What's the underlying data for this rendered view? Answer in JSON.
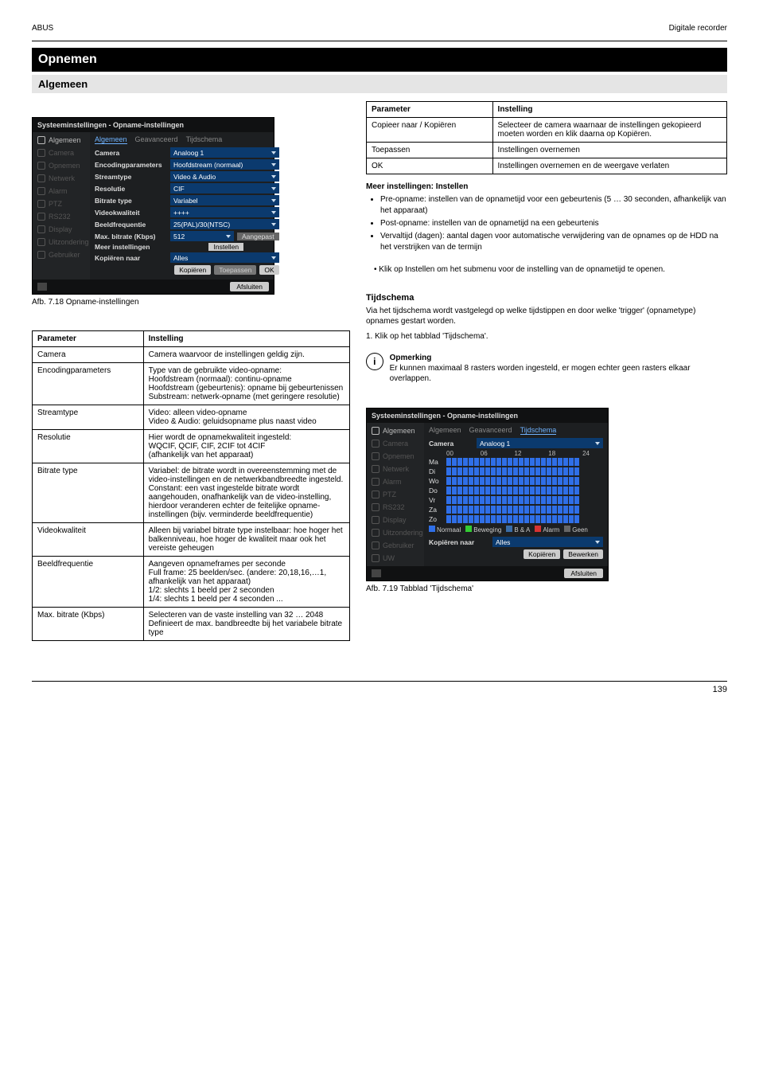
{
  "header": {
    "brand": "ABUS",
    "product": "Digitale recorder"
  },
  "section": {
    "title": "Opnemen",
    "subtitle": "Algemeen"
  },
  "fig1_caption": "Afb. 7.18 Opname-instellingen",
  "fig2_caption": "Afb. 7.19 Tabblad 'Tijdschema'",
  "ui1": {
    "window_title": "Systeeminstellingen - Opname-instellingen",
    "sidebar": [
      "Algemeen",
      "Camera",
      "Opnemen",
      "Netwerk",
      "Alarm",
      "PTZ",
      "RS232",
      "Display",
      "Uitzondering",
      "Gebruiker"
    ],
    "tabs": [
      "Algemeen",
      "Geavanceerd",
      "Tijdschema"
    ],
    "active_tab": 0,
    "rows": [
      {
        "label": "Camera",
        "value": "Analoog 1"
      },
      {
        "label": "Encodingparameters",
        "value": "Hoofdstream (normaal)"
      },
      {
        "label": "Streamtype",
        "value": "Video & Audio"
      },
      {
        "label": "Resolutie",
        "value": "CIF"
      },
      {
        "label": "Bitrate type",
        "value": "Variabel"
      },
      {
        "label": "Videokwaliteit",
        "value": "++++"
      },
      {
        "label": "Beeldfrequentie",
        "value": "25(PAL)/30(NTSC)"
      },
      {
        "label": "Max. bitrate (Kbps)",
        "value": "512",
        "extra": "Aangepast"
      },
      {
        "label": "Meer instellingen",
        "value": "Instellen",
        "type": "button"
      },
      {
        "label": "Kopiëren naar",
        "value": "Alles"
      }
    ],
    "bottom_btns": [
      "Kopiëren",
      "Toepassen",
      "OK"
    ],
    "exit": "Afsluiten"
  },
  "table1": [
    [
      "Parameter",
      "Instelling"
    ],
    [
      "Camera",
      "Camera waarvoor de instellingen geldig zijn."
    ],
    [
      "Encodingparameters",
      "Type van de gebruikte video-opname:\nHoofdstream (normaal): continu-opname\nHoofdstream (gebeurtenis): opname bij gebeurtenissen\nSubstream: netwerk-opname (met geringere resolutie)"
    ],
    [
      "Streamtype",
      "Video: alleen video-opname\nVideo & Audio: geluidsopname plus naast video"
    ],
    [
      "Resolutie",
      "Hier wordt de opnamekwaliteit ingesteld:\nWQCIF, QCIF, CIF, 2CIF tot 4CIF\n(afhankelijk van het apparaat)"
    ],
    [
      "Bitrate type",
      "Variabel: de bitrate wordt in overeenstemming met de video-instellingen en de netwerkbandbreedte ingesteld.\nConstant: een vast ingestelde bitrate wordt aangehouden, onafhankelijk van de video-instelling, hierdoor veranderen echter de feitelijke opname-instellingen (bijv. verminderde beeldfrequentie)"
    ],
    [
      "Videokwaliteit",
      "Alleen bij variabel bitrate type instelbaar: hoe hoger het balkenniveau, hoe hoger de kwaliteit maar ook het vereiste geheugen"
    ],
    [
      "Beeldfrequentie",
      "Aangeven opnameframes per seconde\nFull frame: 25 beelden/sec. (andere: 20,18,16,…1, afhankelijk van het apparaat)\n1/2: slechts 1 beeld per 2 seconden\n1/4: slechts 1 beeld per 4 seconden ..."
    ],
    [
      "Max. bitrate (Kbps)",
      "Selecteren van de vaste instelling van 32 … 2048\nDefinieert de max. bandbreedte bij het variabele bitrate type"
    ]
  ],
  "table2": [
    [
      "Parameter",
      "Instelling"
    ],
    [
      "Copieer naar / Kopiëren",
      "Selecteer de camera waarnaar de instellingen gekopieerd moeten worden en klik daarna op Kopiëren."
    ],
    [
      "Toepassen",
      "Instellingen overnemen"
    ],
    [
      "OK",
      "Instellingen overnemen en de weergave verlaten"
    ]
  ],
  "instellen_block": {
    "title": "Meer instellingen: Instellen",
    "items": [
      "Pre-opname: instellen van de opnametijd voor een gebeurtenis (5 … 30 seconden, afhankelijk van het apparaat)",
      "Post-opname: instellen van de opnametijd na een gebeurtenis",
      "Vervaltijd (dagen): aantal dagen voor automatische verwijdering van de opnames op de HDD na het verstrijken van de termijn"
    ],
    "after": "Klik op Instellen om het submenu voor de instelling van de opnametijd te openen.",
    "tijdschema_title": "Tijdschema",
    "tijdschema_body": "Via het tijdschema wordt vastgelegd op welke tijdstippen en door welke 'trigger' (opnametype) opnames gestart worden.",
    "steps": [
      "1.  Klik op het tabblad 'Tijdschema'."
    ],
    "note_title": "Opmerking",
    "note_body": "Er kunnen maximaal 8 rasters worden ingesteld, er mogen echter geen rasters elkaar overlappen."
  },
  "ui2": {
    "window_title": "Systeeminstellingen - Opname-instellingen",
    "sidebar": [
      "Algemeen",
      "Camera",
      "Opnemen",
      "Netwerk",
      "Alarm",
      "PTZ",
      "RS232",
      "Display",
      "Uitzondering",
      "Gebruiker",
      "UW"
    ],
    "tabs": [
      "Algemeen",
      "Geavanceerd",
      "Tijdschema"
    ],
    "active_tab": 2,
    "camera_label": "Camera",
    "camera_value": "Analoog 1",
    "axis": [
      "00",
      "06",
      "12",
      "18",
      "24"
    ],
    "days": [
      "Ma",
      "Di",
      "Wo",
      "Do",
      "Vr",
      "Za",
      "Zo"
    ],
    "legend": [
      {
        "color": "#2f6fe8",
        "label": "Normaal"
      },
      {
        "color": "#33cc33",
        "label": "Beweging"
      },
      {
        "color": "#3a6da8",
        "label": "B & A"
      },
      {
        "color": "#d83333",
        "label": "Alarm"
      },
      {
        "color": "#666666",
        "label": "Geen"
      }
    ],
    "copy_label": "Kopiëren naar",
    "copy_value": "Alles",
    "bottom_btns": [
      "Kopiëren",
      "Bewerken"
    ],
    "exit": "Afsluiten"
  },
  "footer": {
    "page": "139"
  }
}
